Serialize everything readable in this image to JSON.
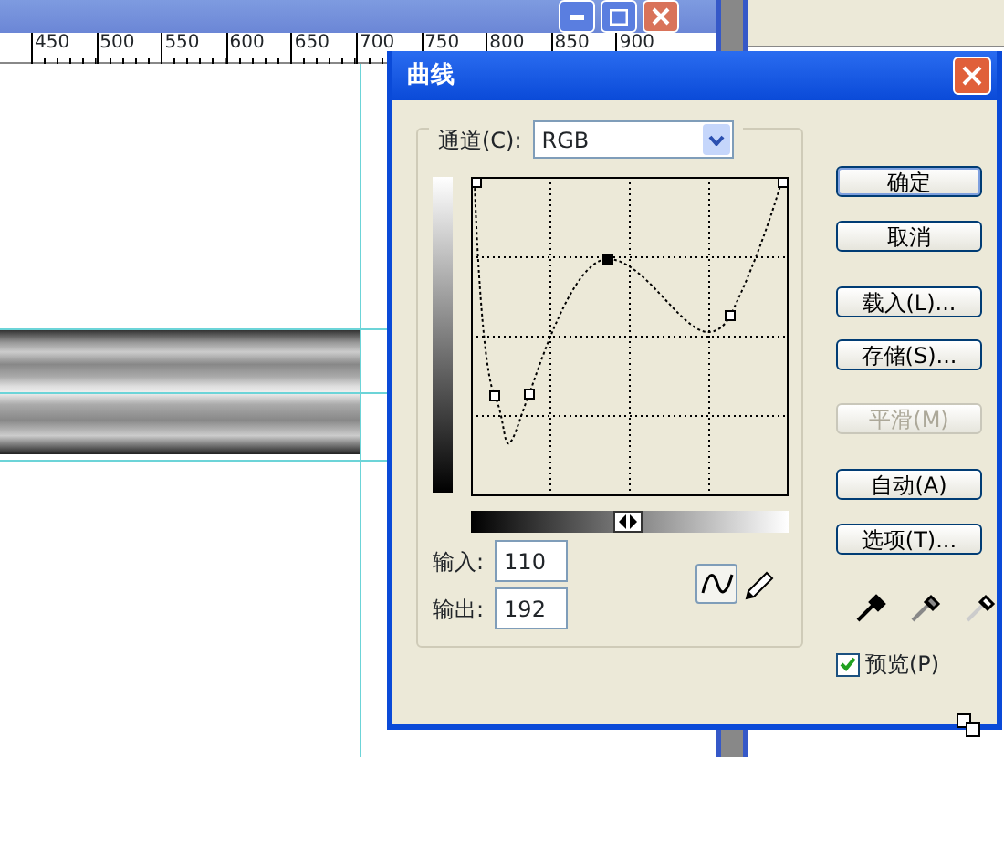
{
  "ruler": {
    "labels": [
      "450",
      "500",
      "550",
      "600",
      "650",
      "700",
      "750",
      "800",
      "850",
      "900"
    ]
  },
  "dialog": {
    "title": "曲线",
    "channel_label": "通道(C):",
    "channel": "RGB",
    "input_label": "输入:",
    "input": "110",
    "output_label": "输出:",
    "output": "192",
    "tools": [
      {
        "kind": "curve",
        "selected": true
      },
      {
        "kind": "pencil",
        "selected": false
      }
    ],
    "buttons": [
      {
        "label": "确定",
        "default": true,
        "disabled": false
      },
      {
        "label": "取消",
        "default": false,
        "disabled": false
      },
      {
        "label": "载入(L)...",
        "default": false,
        "disabled": false
      },
      {
        "label": "存储(S)...",
        "default": false,
        "disabled": false
      },
      {
        "label": "平滑(M)",
        "default": false,
        "disabled": true
      },
      {
        "label": "自动(A)",
        "default": false,
        "disabled": false
      },
      {
        "label": "选项(T)...",
        "default": false,
        "disabled": false
      }
    ],
    "preview": {
      "label": "预览(P)",
      "checked": true
    }
  }
}
